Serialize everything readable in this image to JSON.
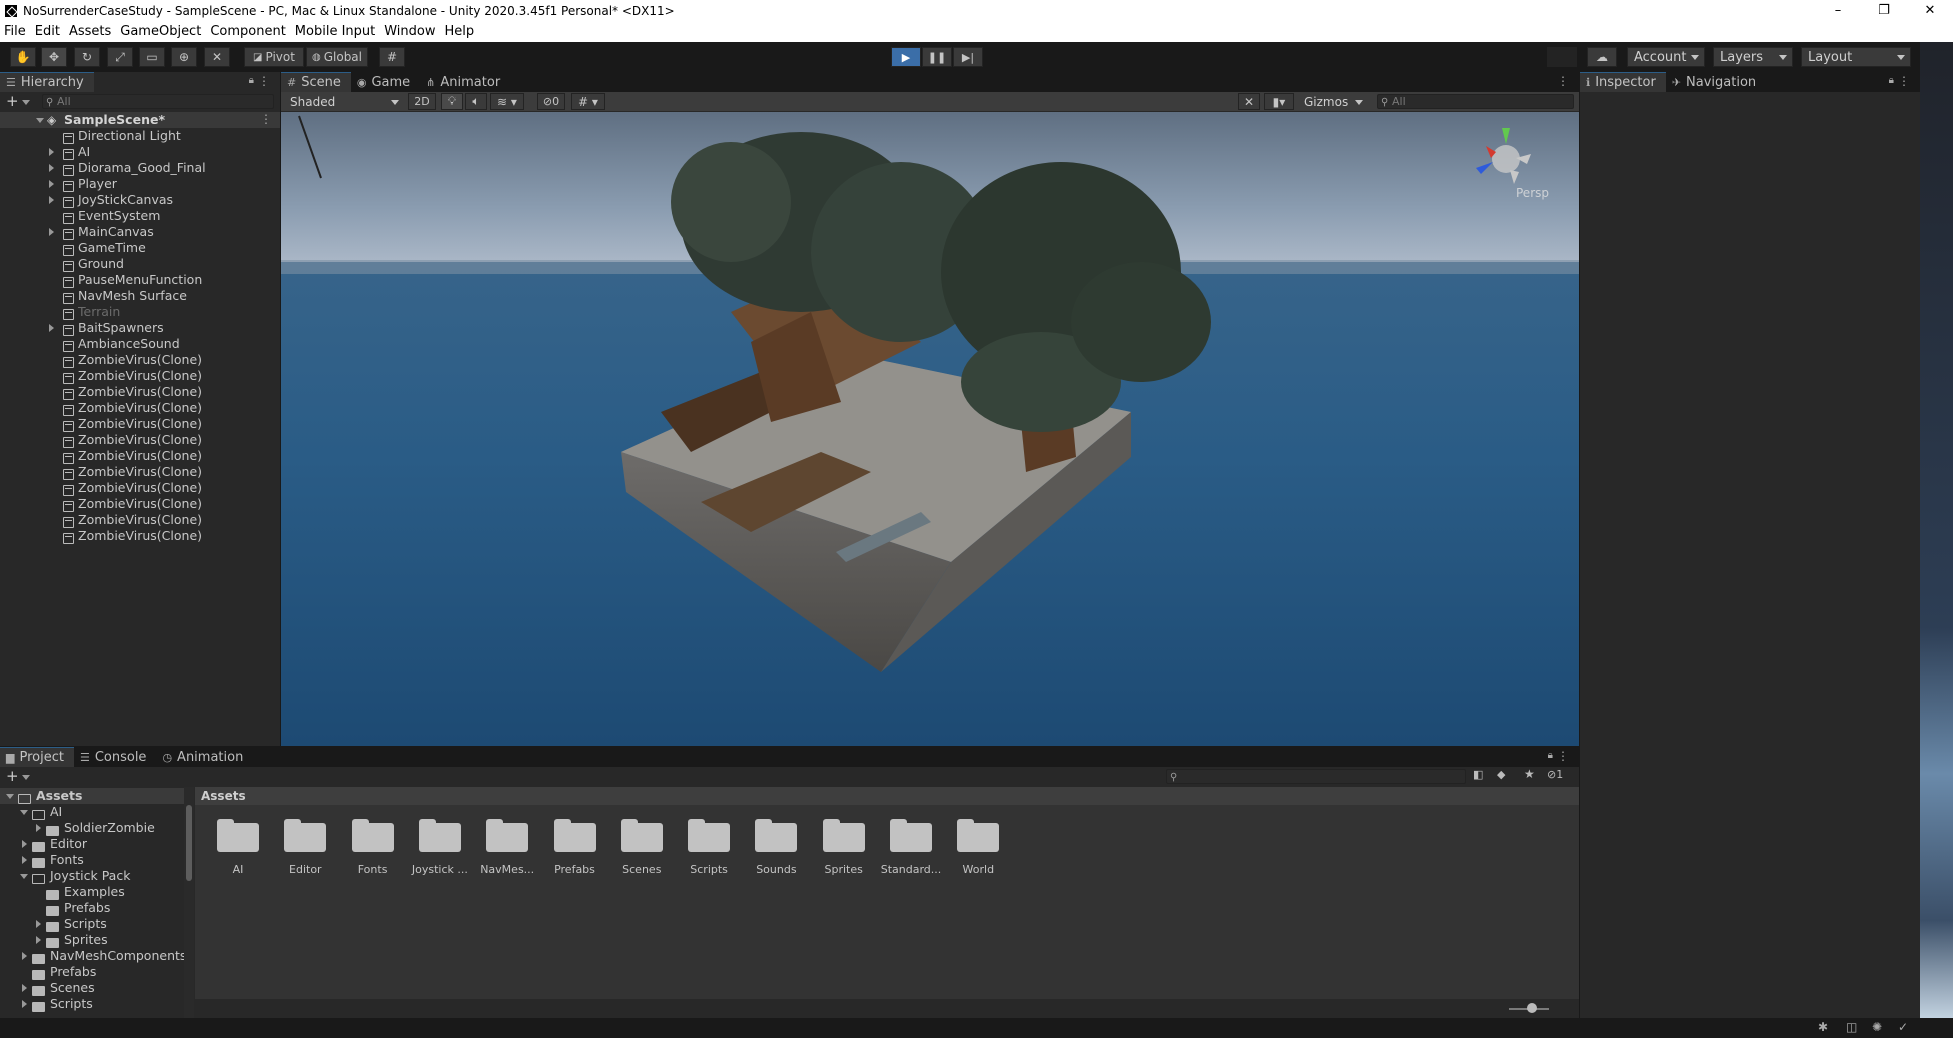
{
  "window": {
    "title": "NoSurrenderCaseStudy - SampleScene - PC, Mac & Linux Standalone - Unity 2020.3.45f1 Personal* <DX11>",
    "minimize": "–",
    "maximize": "❐",
    "close": "✕"
  },
  "menu": [
    "File",
    "Edit",
    "Assets",
    "GameObject",
    "Component",
    "Mobile Input",
    "Window",
    "Help"
  ],
  "toolbar": {
    "pivot": "Pivot",
    "global": "Global",
    "account": "Account",
    "layers": "Layers",
    "layout": "Layout"
  },
  "hierarchy": {
    "tab": "Hierarchy",
    "search_placeholder": "All",
    "scene": "SampleScene*",
    "items": [
      {
        "label": "Directional Light",
        "expand": false,
        "disabled": false
      },
      {
        "label": "AI",
        "expand": true,
        "disabled": false
      },
      {
        "label": "Diorama_Good_Final",
        "expand": true,
        "disabled": false
      },
      {
        "label": "Player",
        "expand": true,
        "disabled": false
      },
      {
        "label": "JoyStickCanvas",
        "expand": true,
        "disabled": false
      },
      {
        "label": "EventSystem",
        "expand": false,
        "disabled": false
      },
      {
        "label": "MainCanvas",
        "expand": true,
        "disabled": false
      },
      {
        "label": "GameTime",
        "expand": false,
        "disabled": false
      },
      {
        "label": "Ground",
        "expand": false,
        "disabled": false
      },
      {
        "label": "PauseMenuFunction",
        "expand": false,
        "disabled": false
      },
      {
        "label": "NavMesh Surface",
        "expand": false,
        "disabled": false
      },
      {
        "label": "Terrain",
        "expand": false,
        "disabled": true
      },
      {
        "label": "BaitSpawners",
        "expand": true,
        "disabled": false
      },
      {
        "label": "AmbianceSound",
        "expand": false,
        "disabled": false
      },
      {
        "label": "ZombieVirus(Clone)",
        "expand": false,
        "disabled": false
      },
      {
        "label": "ZombieVirus(Clone)",
        "expand": false,
        "disabled": false
      },
      {
        "label": "ZombieVirus(Clone)",
        "expand": false,
        "disabled": false
      },
      {
        "label": "ZombieVirus(Clone)",
        "expand": false,
        "disabled": false
      },
      {
        "label": "ZombieVirus(Clone)",
        "expand": false,
        "disabled": false
      },
      {
        "label": "ZombieVirus(Clone)",
        "expand": false,
        "disabled": false
      },
      {
        "label": "ZombieVirus(Clone)",
        "expand": false,
        "disabled": false
      },
      {
        "label": "ZombieVirus(Clone)",
        "expand": false,
        "disabled": false
      },
      {
        "label": "ZombieVirus(Clone)",
        "expand": false,
        "disabled": false
      },
      {
        "label": "ZombieVirus(Clone)",
        "expand": false,
        "disabled": false
      },
      {
        "label": "ZombieVirus(Clone)",
        "expand": false,
        "disabled": false
      },
      {
        "label": "ZombieVirus(Clone)",
        "expand": false,
        "disabled": false
      }
    ]
  },
  "scene": {
    "tabs": [
      "Scene",
      "Game",
      "Animator"
    ],
    "shading": "Shaded",
    "mode_2d": "2D",
    "hidden_count": "0",
    "gizmos": "Gizmos",
    "search_placeholder": "All",
    "persp": "Persp",
    "sky_color": "#8a9cb0",
    "sea_color": "#2a5c86"
  },
  "inspector": {
    "tabs": [
      "Inspector",
      "Navigation"
    ]
  },
  "project": {
    "tabs": [
      "Project",
      "Console",
      "Animation"
    ],
    "breadcrumb": "Assets",
    "count": "1",
    "tree": [
      {
        "label": "Assets",
        "level": 0,
        "open": true,
        "bold": true
      },
      {
        "label": "AI",
        "level": 1,
        "open": true
      },
      {
        "label": "SoldierZombie",
        "level": 2,
        "open": false,
        "arrow": true
      },
      {
        "label": "Editor",
        "level": 1,
        "open": false,
        "arrow": true
      },
      {
        "label": "Fonts",
        "level": 1,
        "open": false,
        "arrow": true
      },
      {
        "label": "Joystick Pack",
        "level": 1,
        "open": true
      },
      {
        "label": "Examples",
        "level": 2,
        "open": false,
        "arrow": false
      },
      {
        "label": "Prefabs",
        "level": 2,
        "open": false,
        "arrow": false
      },
      {
        "label": "Scripts",
        "level": 2,
        "open": false,
        "arrow": true
      },
      {
        "label": "Sprites",
        "level": 2,
        "open": false,
        "arrow": true
      },
      {
        "label": "NavMeshComponents-m",
        "level": 1,
        "open": false,
        "arrow": true
      },
      {
        "label": "Prefabs",
        "level": 1,
        "open": false,
        "arrow": false
      },
      {
        "label": "Scenes",
        "level": 1,
        "open": false,
        "arrow": true
      },
      {
        "label": "Scripts",
        "level": 1,
        "open": false,
        "arrow": true
      }
    ],
    "folders": [
      "AI",
      "Editor",
      "Fonts",
      "Joystick ...",
      "NavMes...",
      "Prefabs",
      "Scenes",
      "Scripts",
      "Sounds",
      "Sprites",
      "Standard...",
      "World"
    ]
  }
}
